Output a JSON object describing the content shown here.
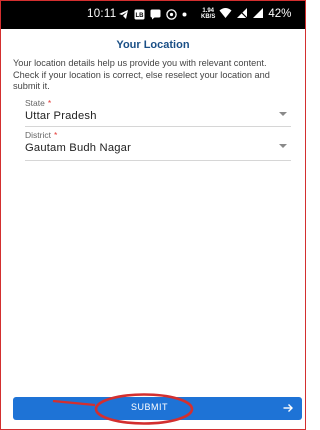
{
  "status_bar": {
    "time": "10:11",
    "network_speed_value": "1.94",
    "network_speed_unit": "KB/S",
    "battery": "42%",
    "icons": [
      "telegram-icon",
      "lb-icon",
      "chat-icon",
      "whatsapp-icon",
      "dot-icon",
      "wifi-icon",
      "muted-icon",
      "signal-icon",
      "battery-icon"
    ]
  },
  "page": {
    "title": "Your Location",
    "intro": "Your location details help us provide you with relevant content. Check if your location is correct, else reselect your location and submit it."
  },
  "form": {
    "state": {
      "label": "State",
      "required_mark": "*",
      "value": "Uttar Pradesh"
    },
    "district": {
      "label": "District",
      "required_mark": "*",
      "value": "Gautam Budh Nagar"
    }
  },
  "actions": {
    "submit_label": "SUBMIT",
    "submit_icon": "arrow-right-icon"
  },
  "colors": {
    "title": "#1a4f86",
    "button": "#1e73d6",
    "annotation": "#d32f2f",
    "required": "#e53935"
  }
}
